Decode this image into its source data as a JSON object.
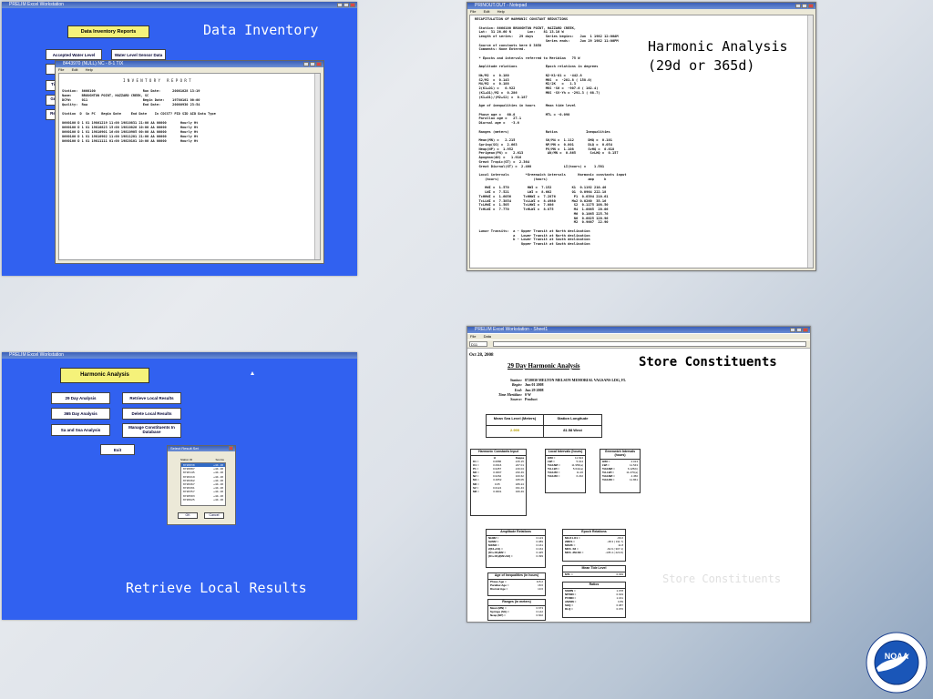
{
  "slide": {
    "logo_text": "NOAA"
  },
  "panel1": {
    "window_title": "PRELIM Excel Workstation",
    "main_button": "Data Inventory Reports",
    "caption": "Data Inventory",
    "side_buttons": [
      "Accepted Water Level",
      "Water Level Sensor Data",
      "",
      "Ti",
      "Gr",
      "Re"
    ],
    "report_window": {
      "title": "8443970 (NULL) NC - 8-1 TIX",
      "menus": [
        "File",
        "Edit",
        "Help"
      ],
      "heading": "I N V E N T O R Y   R E P O R T",
      "lines": [
        "Station:  8660100                        Run Date:      20081028 13:19",
        "Name:     BROUGHTON POINT, HAZZARD CREEK, SC",
        "DCP#:     011                            Begin Date:    19780101 00:00",
        "Quality:  Raw                            End Date:      20080930 23:54",
        "",
        "Station  D  Sn PC   Begin Date     End Date    In CDCST? PID SID AID Data Type",
        "",
        "8660100 D 1 U1 19801219 11:00 19810831 21:00 AA 00000       Hourly Ht",
        "8660100 D 1 U1 19810823 15:00 19810826 10:00 AA 00000       Hourly Ht",
        "8660100 D 1 U1 19810901 16:00 19810905 00:00 AA 00000       Hourly Ht",
        "8660100 D 1 U1 19810902 11:00 19811201 21:00 AA 00000       Hourly Ht",
        "8660100 D 1 U1 19811111 01:00 19820101 10:00 AA 00000       Hourly Ht"
      ]
    }
  },
  "panel2": {
    "window_title": "PRINOUT.OUT - Notepad",
    "menus": [
      "File",
      "Edit",
      "Help"
    ],
    "caption": "Harmonic Analysis\n(29d or 365d)",
    "lines": [
      "RECAPITULATION OF HARMONIC CONSTANT REDUCTIONS",
      "",
      "  Station: 8660100 BROUGHTON POINT, HAZZARD CREEK,",
      "  Lat:  31 26.60 N        Lon:    81 13.10 W",
      "  Length of series:   29 days      Series begins:   Jun  1 1982 12:00AM",
      "                                   Series ends:     Jun 29 1982 11:00PM",
      "  Source of constants here 8 3858",
      "  Comments: None Entered.",
      "",
      "  * Epochs and intervals referred to Meridian   75 W",
      "",
      "  Amplitude relations              Epoch relations in degrees",
      "",
      "  Nk/M2  =  0.180                  N2-K1-O1 =  -442.8",
      "  S2/M2  =  0.143                  MKS  =  -201.8 ( 158.0)",
      "  M4/M2  =  0.188                  M2/2K   =   1.3",
      "  2(K1+O1) =   0.922               MKS -S6 =  -907.6 ( 162.4)",
      "  (K1+O1)/M2 =  0.286              MKS -SV-Yh = -291.3 ( 68.7)",
      "  (K1+O1)/(M2+S2) =  0.187",
      "",
      "  Age of inequalities in hours     Mean tide level",
      "",
      "  Phase age =   60.0               MTL = -0.098",
      "  Parallax age =   27.1",
      "  Diurnal age =   -3.6",
      "",
      "  Ranges (meters)                  Ratios              Inequalities",
      "",
      "  Mean(MN) =   2.215               S6/M4 =  1.112       DHQ =  0.101",
      "  Spring(SG) =  2.663              NP/MN =  0.801       DLQ =  0.054",
      "  Neap(NP) =  1.952                PV/MN =  1.108       SvHQ =  0.618",
      "  Perigean(PN) =   2.613            AN/MN =  0.865       SvLHQ =  0.157",
      "  Apogean(AN) =   1.916",
      "  Great Tropic(GT) =  2.364",
      "  Great Diurnal(GT) =  2.408                LI(hours) =    1.581",
      "",
      "  Local intervals        *Greenwich intervals      Harmonic constants input",
      "     (hours)                 (hours)                    amp     k",
      "",
      "     HWI =  1.570         HWI =  7.152          K1  0.1192 210.40",
      "     LWI =  7.521         LWI =  8.602          O1  0.0964 222.18",
      "  TcHHWI =  1.6056      TcHHWI =  7.2876         P1  0.0394 210.61",
      "  TcLLWI =  7.3854      TcLLWI =  8.4980        Ma2 0.0260  35.16",
      "  TcLHWI =  1.505       TcLHWI =  7.086          S2  0.1175 108.50",
      "  TcHLWI =  7.770       TcHLWI =  8.875          M4  1.0065  20.06",
      "                                                 M6  0.1065 225.76",
      "                                                 N6  0.0025 120.96",
      "                                                 M2  0.9667  22.90",
      "",
      "  Lunar Transits:  a - Upper Transit at North declination",
      "                   a   Lower Transit at North declination",
      "                   b - Lower Transit at South declination",
      "                       Upper Transit at South declination"
    ]
  },
  "panel3": {
    "window_title": "PRELIM Excel Workstation",
    "main_button": "Harmonic Analysis",
    "caption": "Retrieve Local Results",
    "buttons": [
      "29 Day Analysis",
      "365 Day Analysis",
      "Sa and Ssa Analysis",
      "Retrieve Local Results",
      "Delete Local Results",
      "Manage Constituents In Database",
      "Exit"
    ],
    "dialog": {
      "title": "Select Result Set",
      "header": [
        "Station ID",
        "Source"
      ],
      "rows": [
        [
          "8720030",
          "+44.18"
        ],
        [
          "8720087",
          "+44.18"
        ],
        [
          "8720145",
          "+44.18"
        ],
        [
          "8720219",
          "+44.18"
        ],
        [
          "8720262",
          "+44.18"
        ],
        [
          "8720267",
          "+44.18"
        ],
        [
          "8720291",
          "+44.18"
        ],
        [
          "8720357",
          "+44.18"
        ],
        [
          "8720503",
          "+44.18"
        ],
        [
          "8720625",
          "+44.18"
        ]
      ],
      "ok": "OK",
      "cancel": "Cancel"
    }
  },
  "panel4": {
    "window_title": "PRELIM Excel Workstation - Sheet1",
    "menus": [
      "File",
      "Data"
    ],
    "cell_ref": "D11",
    "date": "Oct 28, 2008",
    "caption": "Store Constituents",
    "watermark": "Store Constituents",
    "title": "29 Day Harmonic Analysis",
    "info": [
      [
        "Station:",
        "8720030  MELTON MELSON MEMORIAL VAGSANS LDG, FL"
      ],
      [
        "Begin:",
        "Jun 01 2008"
      ],
      [
        "End:",
        "Jun 29 2008"
      ],
      [
        "Time Meridian:",
        "0 W"
      ],
      [
        "Source:",
        "Product"
      ]
    ],
    "msl": {
      "h1": "Mean Sea Level (Meters)",
      "h2": "Station Longitude",
      "v1": "2.999",
      "v2": "81.58 West"
    },
    "harm": {
      "title": "Harmonic Constants Input",
      "cols": [
        "H",
        "Kappa"
      ],
      "rows": [
        [
          "K1 =",
          "0.0886",
          "215.15"
        ],
        [
          "O1 =",
          "0.0916",
          "227.01"
        ],
        [
          "P1 =",
          "0.0287",
          "216.04"
        ],
        [
          "M2 =",
          "0.0097",
          "230.49"
        ],
        [
          "N2 =",
          "0.0262",
          "100.62"
        ],
        [
          "M4 =",
          "0.4652",
          "345.05"
        ],
        [
          "M6 =",
          "0.05",
          "189.24"
        ],
        [
          "S2 =",
          "0.0124",
          "331.43"
        ],
        [
          "M8 =",
          "0.0001",
          "326.49"
        ]
      ]
    },
    "local": {
      "title": "Local Intervals (hours)",
      "rows": [
        [
          "HWI =",
          "11.624"
        ],
        [
          "LWI =",
          "5.014"
        ],
        [
          "TcHHWI =",
          "11.956(a)"
        ],
        [
          "TcLLWI =",
          "5.641(a)"
        ],
        [
          "TcHLWI =",
          "11.26"
        ],
        [
          "TcHLWI =",
          "6.232"
        ]
      ]
    },
    "green": {
      "title": "Greenwich Intervals (hours)",
      "rows": [
        [
          "HWI =",
          "4.013"
        ],
        [
          "LWI =",
          "11.543"
        ],
        [
          "TcHHWI =",
          "6.125(b)"
        ],
        [
          "TcLLWI =",
          "11.270(a)"
        ],
        [
          "TcHHWI =",
          "4.450"
        ],
        [
          "TcHLWI =",
          "11.861"
        ]
      ]
    },
    "amp": {
      "title": "Amplitude Relations",
      "rows": [
        [
          "Nk/M2 =",
          "0.123"
        ],
        [
          "S2/M2 =",
          "0.089"
        ],
        [
          "M4/M2 =",
          "0.161"
        ],
        [
          "2(K1+O1) =",
          "0.164"
        ],
        [
          "(K1+O1)/M2 =",
          "0.425"
        ],
        [
          "(K1+O1)/(M2+S2) =",
          "0.399"
        ]
      ]
    },
    "epoch": {
      "title": "Epoch Relations",
      "rows": [
        [
          "M2-K1-O1 =",
          "-96.6"
        ],
        [
          "2MKS =",
          "-48.3 ( 311.7)"
        ],
        [
          "M2/2K =",
          "11.8"
        ],
        [
          "MKS -S6 =",
          "-62.9 ( 307.1)"
        ],
        [
          "MKS -2M-SK =",
          "-135.4 ( 224.6)"
        ]
      ]
    },
    "mtl": {
      "title": "Mean Tide Level",
      "rows": [
        [
          "MTL =",
          "0.039"
        ]
      ]
    },
    "ratios": {
      "title": "Ratios",
      "rows": [
        [
          "S6/MN =",
          "1.078"
        ],
        [
          "NP/MN =",
          "0.919"
        ],
        [
          "PV/MN =",
          "1.161"
        ],
        [
          "AN/MN =",
          "0.89"
        ],
        [
          "SHQ =",
          "0.087"
        ],
        [
          "DLQ =",
          "0.076"
        ]
      ]
    },
    "age": {
      "title": "Age of Inequalities (in hours)",
      "rows": [
        [
          "Phase Age =",
          "115.2"
        ],
        [
          "Parallax Age =",
          "18.6"
        ],
        [
          "Diurnal Age =",
          "10.6"
        ]
      ]
    },
    "ranges": {
      "title": "Ranges (in meters)",
      "rows": [
        [
          "Mean (MN) =",
          "0.673"
        ],
        [
          "Springs (SG) =",
          "0.142"
        ],
        [
          "Neap (NP) =",
          "0.602"
        ]
      ]
    }
  }
}
